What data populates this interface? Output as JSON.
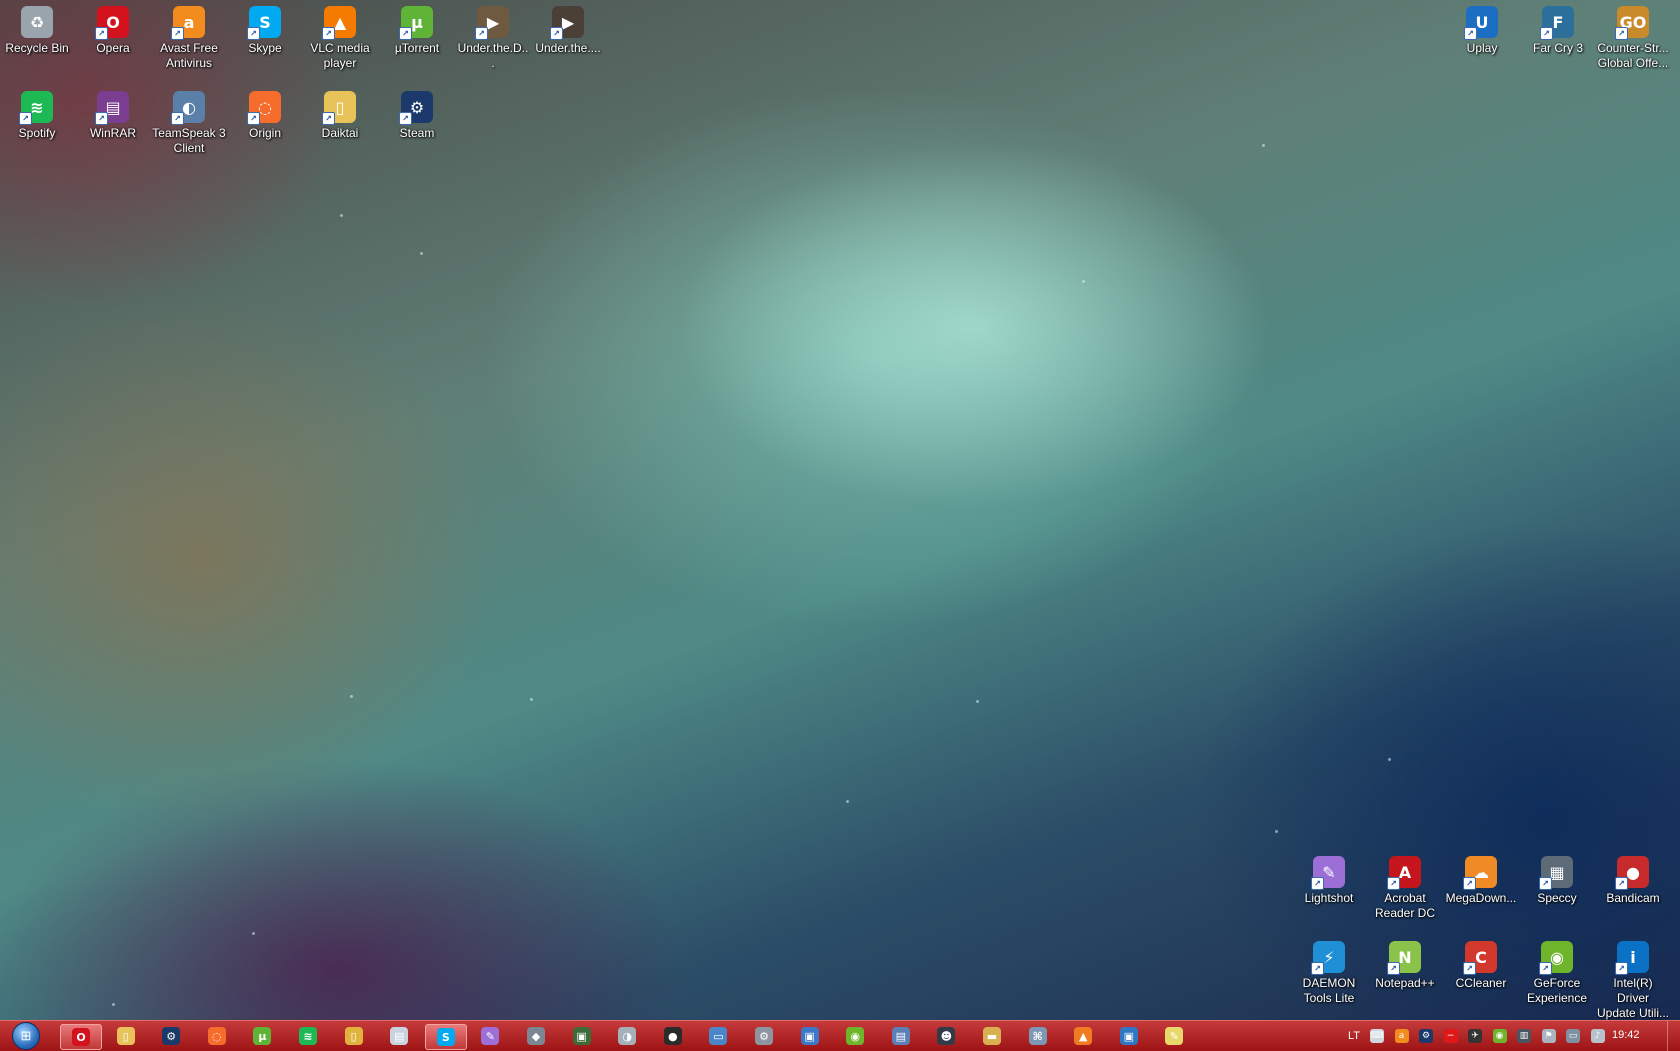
{
  "desktop_icons": [
    {
      "label": "Recycle Bin",
      "icon": "recycle-bin-icon",
      "color": "#9aa4ad",
      "glyph": "♻"
    },
    {
      "label": "Opera",
      "icon": "opera-icon",
      "color": "#d4121e",
      "glyph": "O"
    },
    {
      "label": "Avast Free Antivirus",
      "icon": "avast-icon",
      "color": "#f28c1e",
      "glyph": "a"
    },
    {
      "label": "Skype",
      "icon": "skype-icon",
      "color": "#00a9f0",
      "glyph": "S"
    },
    {
      "label": "VLC media player",
      "icon": "vlc-icon",
      "color": "#f47a00",
      "glyph": "▲"
    },
    {
      "label": "µTorrent",
      "icon": "utorrent-icon",
      "color": "#5fb336",
      "glyph": "µ"
    },
    {
      "label": "Under.the.D...",
      "icon": "video-file-icon",
      "color": "#6d5a40",
      "glyph": "▶"
    },
    {
      "label": "Under.the....",
      "icon": "video-file-icon",
      "color": "#4a4036",
      "glyph": "▶"
    },
    {
      "label": "Spotify",
      "icon": "spotify-icon",
      "color": "#1db954",
      "glyph": "≋"
    },
    {
      "label": "WinRAR",
      "icon": "winrar-icon",
      "color": "#7b3d8f",
      "glyph": "▤"
    },
    {
      "label": "TeamSpeak 3 Client",
      "icon": "teamspeak-icon",
      "color": "#5a7fa8",
      "glyph": "◐"
    },
    {
      "label": "Origin",
      "icon": "origin-icon",
      "color": "#f56c2d",
      "glyph": "◌"
    },
    {
      "label": "Daiktai",
      "icon": "folder-icon",
      "color": "#e8c35a",
      "glyph": "▯"
    },
    {
      "label": "Steam",
      "icon": "steam-icon",
      "color": "#1b3a6b",
      "glyph": "⚙"
    },
    {
      "label": "Uplay",
      "icon": "uplay-icon",
      "color": "#1b6ec2",
      "glyph": "U"
    },
    {
      "label": "Far Cry 3",
      "icon": "farcry3-icon",
      "color": "#2c6f9a",
      "glyph": "F"
    },
    {
      "label": "Counter-Str... Global Offe...",
      "icon": "csgo-icon",
      "color": "#c98a2b",
      "glyph": "GO"
    },
    {
      "label": "Lightshot",
      "icon": "lightshot-icon",
      "color": "#9b6fd6",
      "glyph": "✎"
    },
    {
      "label": "Acrobat Reader DC",
      "icon": "acrobat-icon",
      "color": "#c4161c",
      "glyph": "A"
    },
    {
      "label": "MegaDown...",
      "icon": "megadownloader-icon",
      "color": "#f08a24",
      "glyph": "☁"
    },
    {
      "label": "Speccy",
      "icon": "speccy-icon",
      "color": "#5d6b78",
      "glyph": "▦"
    },
    {
      "label": "Bandicam",
      "icon": "bandicam-icon",
      "color": "#c72a2a",
      "glyph": "●"
    },
    {
      "label": "DAEMON Tools Lite",
      "icon": "daemon-tools-icon",
      "color": "#1f8fd6",
      "glyph": "⚡"
    },
    {
      "label": "Notepad++",
      "icon": "notepadpp-icon",
      "color": "#8bc34a",
      "glyph": "N"
    },
    {
      "label": "CCleaner",
      "icon": "ccleaner-icon",
      "color": "#d3382c",
      "glyph": "C"
    },
    {
      "label": "GeForce Experience",
      "icon": "geforce-icon",
      "color": "#6fb52c",
      "glyph": "◉"
    },
    {
      "label": "Intel(R) Driver Update Utili...",
      "icon": "intel-icon",
      "color": "#0a71c5",
      "glyph": "i"
    }
  ],
  "taskbar": {
    "start_icon": "windows-start-icon",
    "pinned": [
      {
        "icon": "opera-icon",
        "color": "#d4121e",
        "glyph": "O",
        "active": true
      },
      {
        "icon": "explorer-icon",
        "color": "#e8c35a",
        "glyph": "▯",
        "active": false
      },
      {
        "icon": "steam-icon",
        "color": "#1b3a6b",
        "glyph": "⚙",
        "active": false
      },
      {
        "icon": "origin-icon",
        "color": "#f56c2d",
        "glyph": "◌",
        "active": false
      },
      {
        "icon": "utorrent-icon",
        "color": "#5fb336",
        "glyph": "µ",
        "active": false
      },
      {
        "icon": "spotify-icon",
        "color": "#1db954",
        "glyph": "≋",
        "active": false
      },
      {
        "icon": "folder-icon",
        "color": "#e0b43c",
        "glyph": "▯",
        "active": false
      },
      {
        "icon": "document-icon",
        "color": "#c9d3e0",
        "glyph": "▤",
        "active": false
      },
      {
        "icon": "skype-icon",
        "color": "#00a9f0",
        "glyph": "S",
        "active": true
      },
      {
        "icon": "lightshot-icon",
        "color": "#9b6fd6",
        "glyph": "✎",
        "active": false
      },
      {
        "icon": "game-icon",
        "color": "#7b8894",
        "glyph": "◆",
        "active": false
      },
      {
        "icon": "monitor-icon",
        "color": "#3e6b3a",
        "glyph": "▣",
        "active": false
      },
      {
        "icon": "disc-icon",
        "color": "#a5b0ba",
        "glyph": "◑",
        "active": false
      },
      {
        "icon": "bandicam-icon",
        "color": "#2b2b2b",
        "glyph": "●",
        "active": false
      },
      {
        "icon": "window-icon",
        "color": "#4c86c9",
        "glyph": "▭",
        "active": false
      },
      {
        "icon": "gear-icon",
        "color": "#8d96a0",
        "glyph": "⚙",
        "active": false
      },
      {
        "icon": "display-icon",
        "color": "#3b78c8",
        "glyph": "▣",
        "active": false
      },
      {
        "icon": "nvidia-icon",
        "color": "#6fb52c",
        "glyph": "◉",
        "active": false
      },
      {
        "icon": "installer-icon",
        "color": "#5c7fb8",
        "glyph": "▤",
        "active": false
      },
      {
        "icon": "agent-icon",
        "color": "#333c46",
        "glyph": "☻",
        "active": false
      },
      {
        "icon": "archive-icon",
        "color": "#d8b050",
        "glyph": "▬",
        "active": false
      },
      {
        "icon": "network-icon",
        "color": "#7d97b6",
        "glyph": "⌘",
        "active": false
      },
      {
        "icon": "fire-icon",
        "color": "#f07b21",
        "glyph": "▲",
        "active": false
      },
      {
        "icon": "remote-desktop-icon",
        "color": "#2f78c4",
        "glyph": "▣",
        "active": false
      },
      {
        "icon": "notepad-icon",
        "color": "#e8d86a",
        "glyph": "✎",
        "active": false
      }
    ],
    "tray": {
      "language": "LT",
      "icons": [
        {
          "icon": "keyboard-icon",
          "color": "#cfd6dd",
          "glyph": "⌨"
        },
        {
          "icon": "avast-tray-icon",
          "color": "#f28c1e",
          "glyph": "a"
        },
        {
          "icon": "steam-tray-icon",
          "color": "#1b3a6b",
          "glyph": "⚙"
        },
        {
          "icon": "blocked-icon",
          "color": "#e01818",
          "glyph": "−"
        },
        {
          "icon": "satellite-icon",
          "color": "#333333",
          "glyph": "✈"
        },
        {
          "icon": "nvidia-tray-icon",
          "color": "#6fb52c",
          "glyph": "◉"
        },
        {
          "icon": "network-tray-icon",
          "color": "#4a5560",
          "glyph": "▥"
        },
        {
          "icon": "flag-icon",
          "color": "#aab4be",
          "glyph": "⚑"
        },
        {
          "icon": "monitor-tray-icon",
          "color": "#8090a0",
          "glyph": "▭"
        },
        {
          "icon": "volume-icon",
          "color": "#b8c2cc",
          "glyph": "♪"
        }
      ],
      "clock": "19:42"
    }
  }
}
